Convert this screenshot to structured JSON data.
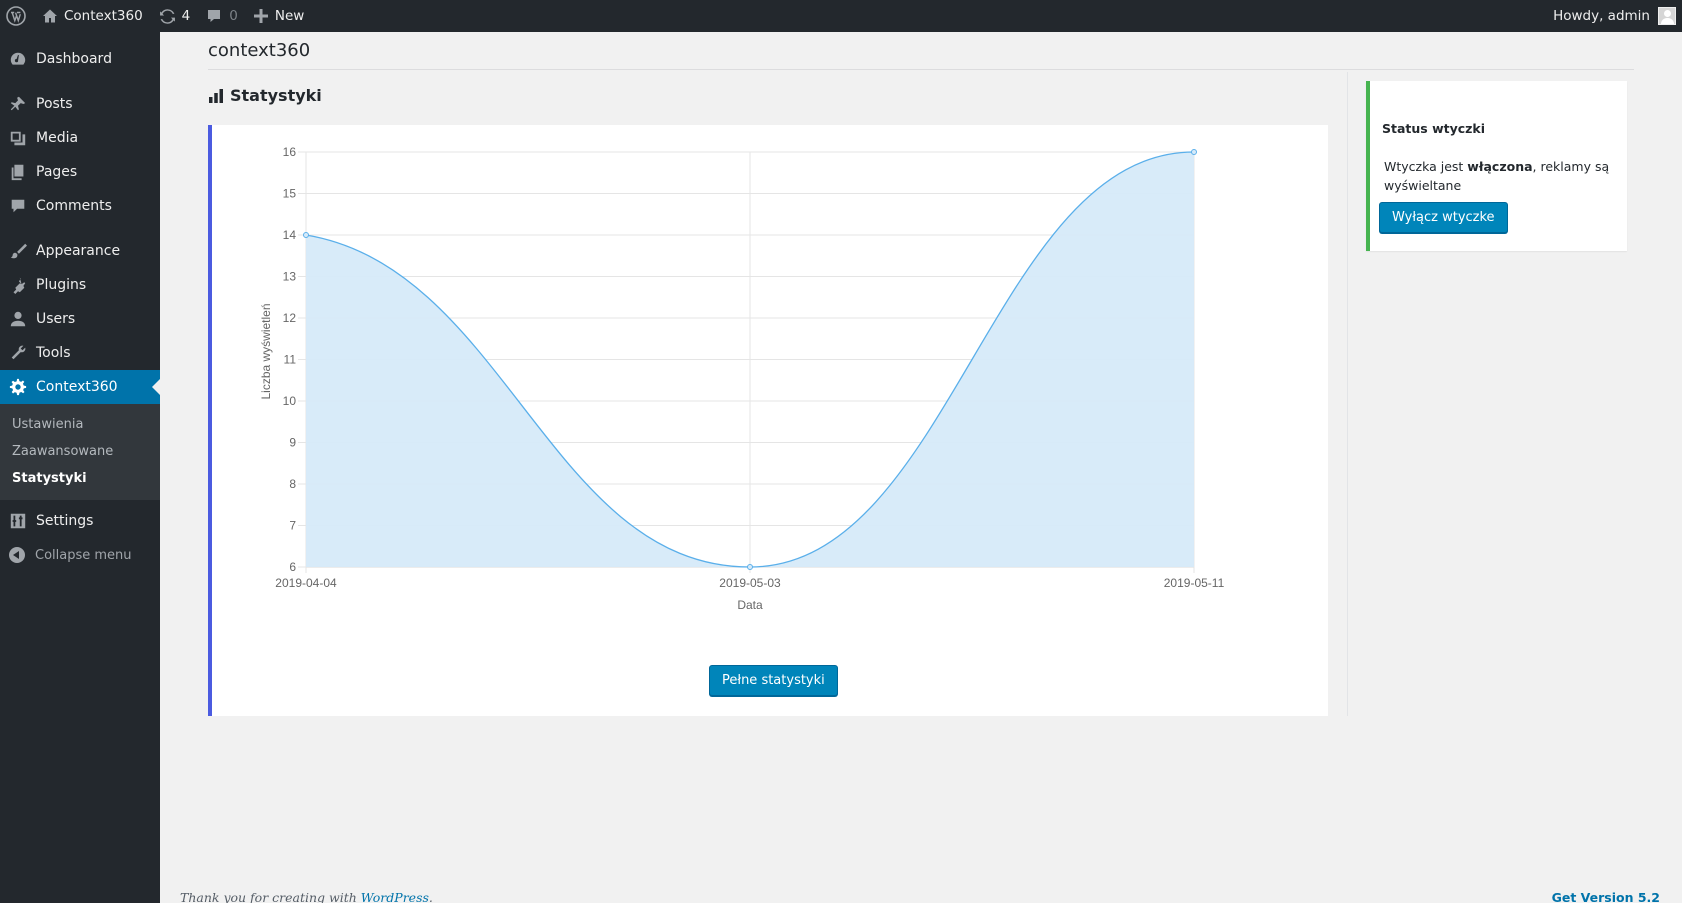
{
  "adminbar": {
    "site_name": "Context360",
    "updates_count": "4",
    "comments_count": "0",
    "new_label": "New",
    "howdy": "Howdy, admin"
  },
  "sidebar": {
    "items": [
      {
        "label": "Dashboard",
        "icon": "dashboard-icon"
      },
      {
        "label": "Posts",
        "icon": "pushpin-icon"
      },
      {
        "label": "Media",
        "icon": "media-icon"
      },
      {
        "label": "Pages",
        "icon": "pages-icon"
      },
      {
        "label": "Comments",
        "icon": "comment-icon"
      },
      {
        "label": "Appearance",
        "icon": "brush-icon"
      },
      {
        "label": "Plugins",
        "icon": "plug-icon"
      },
      {
        "label": "Users",
        "icon": "user-icon"
      },
      {
        "label": "Tools",
        "icon": "wrench-icon"
      },
      {
        "label": "Context360",
        "icon": "gear-icon",
        "current": true
      },
      {
        "label": "Settings",
        "icon": "settings-icon"
      }
    ],
    "submenu": [
      {
        "label": "Ustawienia"
      },
      {
        "label": "Zaawansowane"
      },
      {
        "label": "Statystyki",
        "current": true
      }
    ],
    "collapse_label": "Collapse menu"
  },
  "main": {
    "page_title": "context360",
    "section_title": "Statystyki",
    "full_stats_button": "Pełne statystyki"
  },
  "status": {
    "title": "Status wtyczki",
    "text_before": "Wtyczka jest ",
    "text_bold": "włączona",
    "text_after": ", reklamy są wyświeltane",
    "button": "Wyłącz wtyczke"
  },
  "footer": {
    "thanks_prefix": "Thank you for creating with ",
    "thanks_link": "WordPress",
    "thanks_suffix": ".",
    "version": "Get Version 5.2"
  },
  "colors": {
    "accent": "#0073aa",
    "chart_line": "#5aafea",
    "chart_fill": "#d6eaf9",
    "chart_card_border": "#4b5be0",
    "status_border": "#46b450"
  },
  "chart_data": {
    "type": "area",
    "x": [
      "2019-04-04",
      "2019-05-03",
      "2019-05-11"
    ],
    "values": [
      14,
      6,
      16
    ],
    "xlabel": "Data",
    "ylabel": "Liczba wyświetleń",
    "ylim": [
      6,
      16
    ],
    "yticks": [
      6,
      7,
      8,
      9,
      10,
      11,
      12,
      13,
      14,
      15,
      16
    ],
    "grid": true
  }
}
